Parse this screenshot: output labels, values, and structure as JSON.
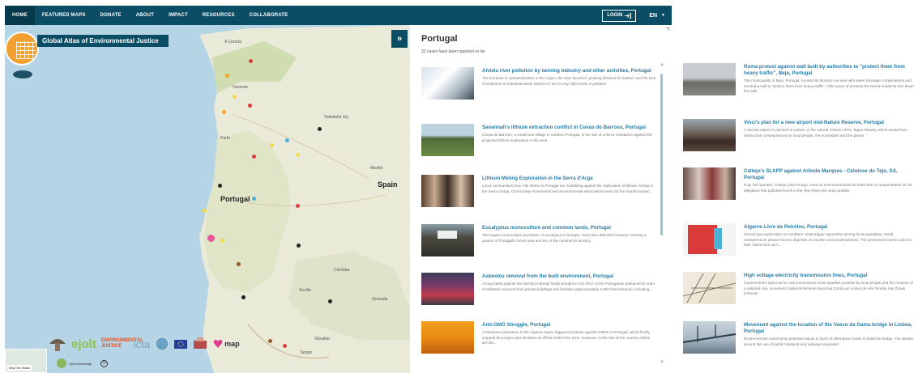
{
  "nav": {
    "items": [
      {
        "label": "HOME",
        "active": true
      },
      {
        "label": "FEATURED MAPS"
      },
      {
        "label": "DONATE"
      },
      {
        "label": "ABOUT"
      },
      {
        "label": "IMPACT"
      },
      {
        "label": "RESOURCES"
      },
      {
        "label": "COLLABORATE"
      }
    ],
    "login_label": "LOGIN",
    "lang": "EN"
  },
  "map": {
    "title": "Global Atlas of Environmental Justice",
    "labels": {
      "a_coruna": "A Coruña",
      "ourense": "Ourense",
      "valladolid": "Valladolid city",
      "porto": "Porto",
      "madrid": "Madrid",
      "spain": "Spain",
      "portugal": "Portugal",
      "cordoba": "Córdoba",
      "sevilla": "Sevilla",
      "granada": "Granada",
      "gibraltar": "Gibraltar",
      "tanger": "Tanger"
    },
    "partners": [
      "ejolt",
      "ENVIRONMENTAL JUSTICE",
      "icta",
      "map"
    ],
    "basemap_label": "MapTiler Basic",
    "osm_label": "OpenStreetMap",
    "osm_copyright": "©",
    "marker_colors": [
      "#e03b3b",
      "#f5a623",
      "#f7d84a",
      "#4ab0d8",
      "#222222",
      "#e8589a",
      "#8a5a2b"
    ]
  },
  "panel": {
    "title": "Portugal",
    "subtitle": "22 cases have been reported so far",
    "cases": [
      {
        "title": "Alviela river pollution by tanning industry and other activities, Portugal",
        "desc": "The increase in industrialization in the region, the slow factories' growing demand for leather, and the lack of treatment of industrial waste linked to it led to very high levels of pollution"
      },
      {
        "title": "Savannah's lithium extraction conflict in Covas do Barroso, Portugal",
        "desc": "Covas do Barroso, a small rural village in northern Portugal, is the site of a fierce resistance against the projected lithium exploration in the area"
      },
      {
        "title": "Lithium Mining Exploration in the Serra d'Arga",
        "desc": "Local communities from Alto Minho in Portugal are mobilising against the exploration of lithium mining in the Serra d'Arga. Civil society movements and environmental associations warn for the harmful impac..."
      },
      {
        "title": "Eucalyptus monoculture and common lands, Portugal",
        "desc": "The largest monoculture plantation of eucalyptus in Europe: more than 800,000 hectares covering a quarter of Portugal's forest area and 9% of the continent's territory"
      },
      {
        "title": "Asbestos removal from the built environment, Portugal",
        "desc": "A long battle against the harmful material finally brought in Oct 2017 to the Portuguese parliament's order of asbestos removal from private buildings and facilities (approximately 4,000 interventions), including..."
      },
      {
        "title": "Anti-GMO Struggle, Portugal",
        "desc": "A Monsanto plantation in the Algarve region triggered protests against GMOs in Portugal, which finally stopped the project and declared an official GMO-free zone. However, in the rest of the country GMOs are stil..."
      }
    ]
  },
  "column2": {
    "cases": [
      {
        "title": "Roma protest against wall built by authorities to \"protect them from heavy traffic\", Beja, Portugal",
        "desc": "The municipality of Beja, Portugal, housed 50 Roma in an area with water drainage complications and erected a wall to \"protect them from heavy traffic\". After years of protests the Roma residents tore down the wall."
      },
      {
        "title": "Vinci's plan for a new airport mid-Nature Reserve, Portugal",
        "desc": "A second airport is planned in Lisbon, in the natural reserve of the Tagus estuary, which would have destructive consequences for local people, the ecosystem and the planet."
      },
      {
        "title": "Celtejo's SLAPP against Arlindo Marques - Celulose do Tejo, SA, Portugal",
        "desc": "Pulp mill operator, Celtejo (Altri Group), sued an environmentalist for €250,000 in compensation for his allegation that pollution levels in the Tejo River are unacceptable."
      },
      {
        "title": "Algarve Livre de Petróleo, Portugal",
        "desc": "Oil and gas exploration on Southern coast trigger opposition among local population, small entrepreneurs whose income depends on tourism and small business. The government seems deaf to their claims but can't..."
      },
      {
        "title": "High voltage electricity transmission lines, Portugal",
        "desc": "Government's approval for new transmission lines sparkles protests by local people and the creation of a national civic movement called Movimento Nacional Contra as Linhas de Alta Tensão nas Zonas Urbanas"
      },
      {
        "title": "Movement against the location of the Vasco da Gama bridge in Lisboa, Portugal",
        "desc": "Environmental movements protested about in favor of alternative routes to build the bridge. The debate around the use of public transport and railways expanded."
      }
    ]
  }
}
